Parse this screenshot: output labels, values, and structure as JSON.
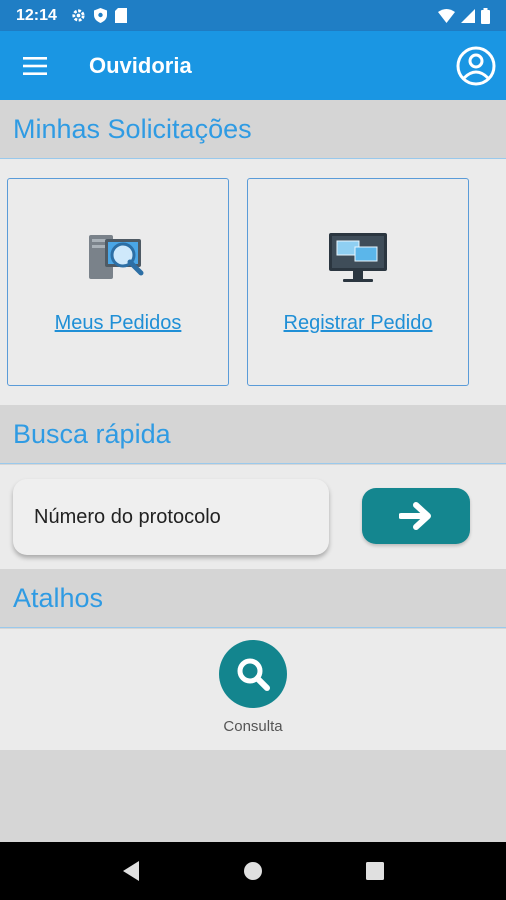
{
  "status_bar": {
    "time": "12:14",
    "left_icons": [
      "gear-icon",
      "shield-icon",
      "sd-card-icon"
    ],
    "right_icons": [
      "wifi-icon",
      "signal-icon",
      "battery-icon"
    ]
  },
  "app_bar": {
    "title": "Ouvidoria",
    "menu_icon": "hamburger-menu-icon",
    "account_icon": "account-circle-icon",
    "color": "#1a96e3"
  },
  "sections": {
    "requests": {
      "title": "Minhas Solicitações"
    },
    "quick_search": {
      "title": "Busca rápida"
    },
    "shortcuts": {
      "title": "Atalhos"
    }
  },
  "cards": [
    {
      "label": "Meus Pedidos",
      "icon": "computer-magnifier-icon"
    },
    {
      "label": "Registrar Pedido",
      "icon": "monitor-windows-icon"
    }
  ],
  "search": {
    "placeholder": "Número do protocolo",
    "value": "",
    "button_icon": "arrow-right-icon",
    "button_color": "#14868f"
  },
  "shortcuts": [
    {
      "label": "Consulta",
      "icon": "search-icon"
    }
  ],
  "nav_bar": {
    "buttons": [
      "back-triangle-icon",
      "home-circle-icon",
      "recents-square-icon"
    ]
  },
  "colors": {
    "accent": "#2f9be3",
    "link": "#1f8fd6",
    "teal": "#14868f",
    "status_bar": "#1f7ec5"
  }
}
